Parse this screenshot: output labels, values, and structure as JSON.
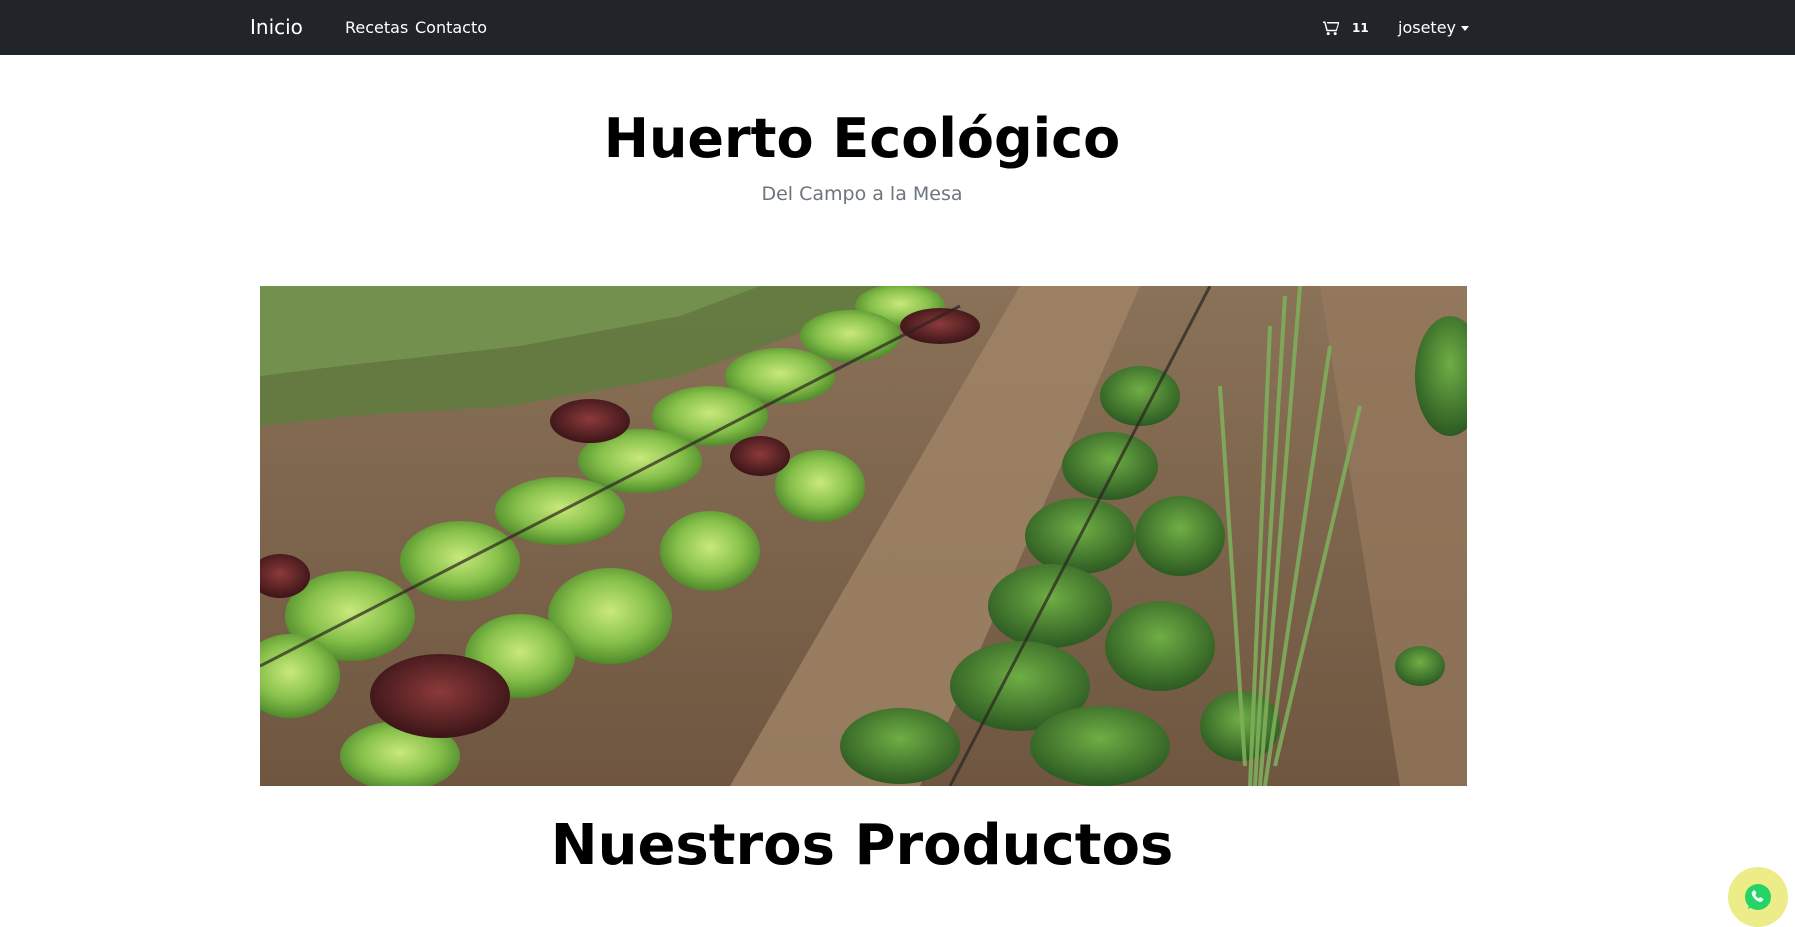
{
  "navbar": {
    "brand": "Inicio",
    "links": [
      "Recetas",
      "Contacto"
    ],
    "cart": {
      "icon": "cart-icon",
      "count": "11"
    },
    "user": {
      "name": "josetey",
      "icon": "caret-down-icon"
    }
  },
  "hero": {
    "title": "Huerto Ecológico",
    "subtitle": "Del Campo a la Mesa",
    "image": {
      "subject": "vegetable garden rows with lettuces and onions"
    }
  },
  "section": {
    "title": "Nuestros Productos"
  },
  "whatsapp": {
    "icon": "whatsapp-icon"
  },
  "colors": {
    "navbar_bg": "#212529",
    "subtitle": "#6c757d",
    "whatsapp_bg": "#ecec88",
    "whatsapp_green": "#25d366"
  }
}
